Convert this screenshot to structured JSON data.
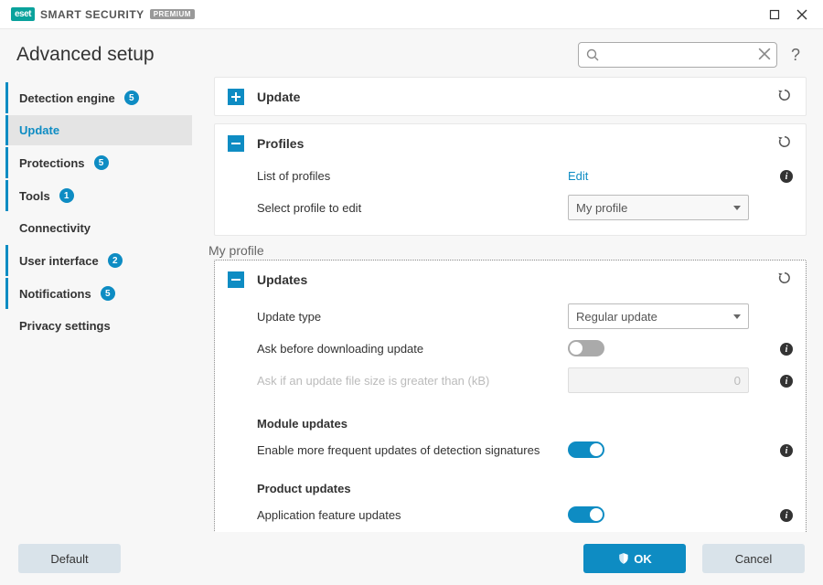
{
  "titlebar": {
    "brand_logo": "eset",
    "brand_text": "SMART SECURITY",
    "brand_badge": "PREMIUM"
  },
  "header": {
    "title": "Advanced setup",
    "search_placeholder": "",
    "help": "?"
  },
  "sidebar": {
    "items": [
      {
        "label": "Detection engine",
        "badge": "5",
        "bar": true
      },
      {
        "label": "Update",
        "badge": "",
        "bar": true,
        "active": true
      },
      {
        "label": "Protections",
        "badge": "5",
        "bar": true
      },
      {
        "label": "Tools",
        "badge": "1",
        "bar": true
      },
      {
        "label": "Connectivity",
        "badge": "",
        "bar": false
      },
      {
        "label": "User interface",
        "badge": "2",
        "bar": true
      },
      {
        "label": "Notifications",
        "badge": "5",
        "bar": true
      },
      {
        "label": "Privacy settings",
        "badge": "",
        "bar": false
      }
    ]
  },
  "content": {
    "update_panel": {
      "title": "Update"
    },
    "profiles_panel": {
      "title": "Profiles",
      "list_label": "List of profiles",
      "list_action": "Edit",
      "select_label": "Select profile to edit",
      "select_value": "My profile"
    },
    "profile_heading": "My profile",
    "updates_panel": {
      "title": "Updates",
      "update_type_label": "Update type",
      "update_type_value": "Regular update",
      "ask_before_label": "Ask before downloading update",
      "ask_before_value": false,
      "ask_size_label": "Ask if an update file size is greater than (kB)",
      "ask_size_value": "0",
      "module_heading": "Module updates",
      "frequent_label": "Enable more frequent updates of detection signatures",
      "frequent_value": true,
      "product_heading": "Product updates",
      "app_feature_label": "Application feature updates",
      "app_feature_value": true
    }
  },
  "footer": {
    "default": "Default",
    "ok": "OK",
    "cancel": "Cancel"
  }
}
